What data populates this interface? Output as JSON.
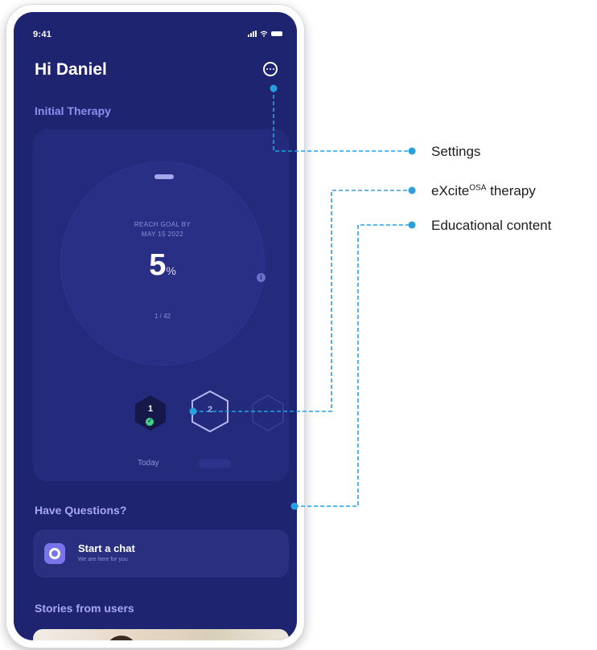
{
  "status_bar": {
    "time": "9:41"
  },
  "header": {
    "greeting": "Hi Daniel"
  },
  "therapy": {
    "section_title": "Initial Therapy",
    "goal_line1": "REACH GOAL BY",
    "goal_line2": "MAY 15 2022",
    "percent": "5",
    "percent_unit": "%",
    "days": "1 / 42",
    "progress": 0.05,
    "days_strip": [
      {
        "number": "1",
        "label": "Today",
        "completed": true
      },
      {
        "number": "2",
        "label": "",
        "completed": false
      }
    ]
  },
  "questions": {
    "section_title": "Have Questions?",
    "chat_title": "Start a chat",
    "chat_subtitle": "We are here for you"
  },
  "stories": {
    "section_title": "Stories from users"
  },
  "callouts": {
    "settings": "Settings",
    "therapy_main": "eXcite",
    "therapy_sup": "OSA",
    "therapy_tail": " therapy",
    "education": "Educational content"
  },
  "colors": {
    "background": "#1f2470",
    "card": "#252b7c",
    "accent": "#8e8ff0",
    "callout_line": "#2a9fdf",
    "success": "#3fd48a"
  },
  "icons": [
    "more-icon",
    "info-icon",
    "check-icon",
    "chat-icon",
    "signal-icon",
    "wifi-icon",
    "battery-icon"
  ]
}
